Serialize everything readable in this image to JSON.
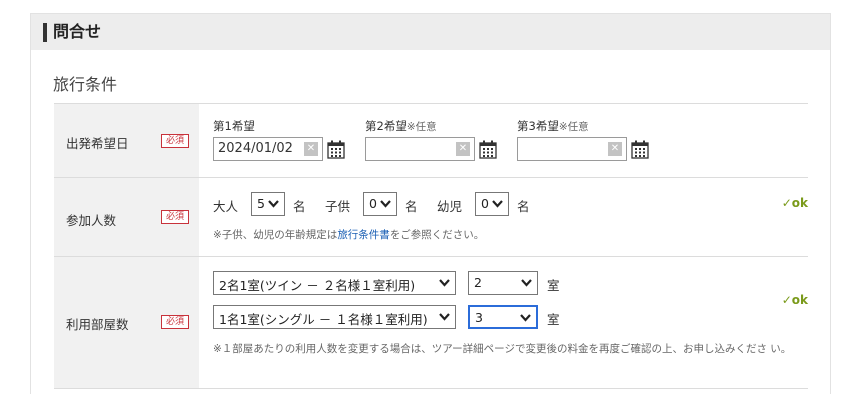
{
  "panel": {
    "title": "問合せ"
  },
  "section": {
    "title": "旅行条件"
  },
  "required_label": "必須",
  "departure": {
    "label": "出発希望日",
    "first": {
      "label": "第1希望",
      "value": "2024/01/02"
    },
    "second": {
      "label": "第2希望",
      "optional": "※任意",
      "value": ""
    },
    "third": {
      "label": "第3希望",
      "optional": "※任意",
      "value": ""
    }
  },
  "participants": {
    "label": "参加人数",
    "adult": {
      "label": "大人",
      "value": "5",
      "unit": "名"
    },
    "child": {
      "label": "子供",
      "value": "0",
      "unit": "名"
    },
    "infant": {
      "label": "幼児",
      "value": "0",
      "unit": "名"
    },
    "note_prefix": "※子供、幼児の年齢規定は",
    "note_link": "旅行条件書",
    "note_suffix": "をご参照ください。",
    "status": "ok"
  },
  "rooms": {
    "label": "利用部屋数",
    "room1": {
      "type": "2名1室(ツイン － ２名様１室利用)",
      "count": "2",
      "unit": "室"
    },
    "room2": {
      "type": "1名1室(シングル － １名様１室利用)",
      "count": "3",
      "unit": "室"
    },
    "note": "※１部屋あたりの利用人数を変更する場合は、ツアー詳細ページで変更後の料金を再度ご確認の上、お申し込みくださ い。",
    "status": "ok"
  },
  "icons": {
    "clear": "clear-icon",
    "calendar": "calendar-icon",
    "check": "check-icon",
    "dropdown": "chevron-down-icon"
  },
  "colors": {
    "required": "#c8323b",
    "ok": "#7a9a1a",
    "link": "#1a5fb4",
    "focus": "#2b6cd9"
  }
}
